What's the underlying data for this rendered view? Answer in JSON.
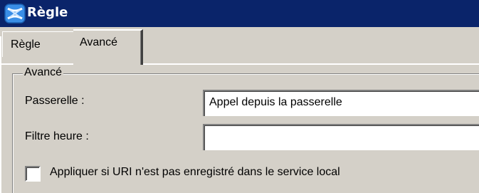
{
  "window": {
    "title": "Règle",
    "icon": "rule-app-icon",
    "titlebar_color": "#0a246a",
    "background_color": "#d4d0c8"
  },
  "tabs": [
    {
      "label": "Règle",
      "selected": false
    },
    {
      "label": "Avancé",
      "selected": true
    }
  ],
  "group": {
    "legend": "Avancé"
  },
  "fields": {
    "passerelle": {
      "label": "Passerelle :",
      "value": "Appel depuis la passerelle"
    },
    "filtre_heure": {
      "label": "Filtre heure :",
      "value": ""
    }
  },
  "checkbox": {
    "label": "Appliquer si URI n'est pas enregistré dans le service local",
    "checked": false
  }
}
